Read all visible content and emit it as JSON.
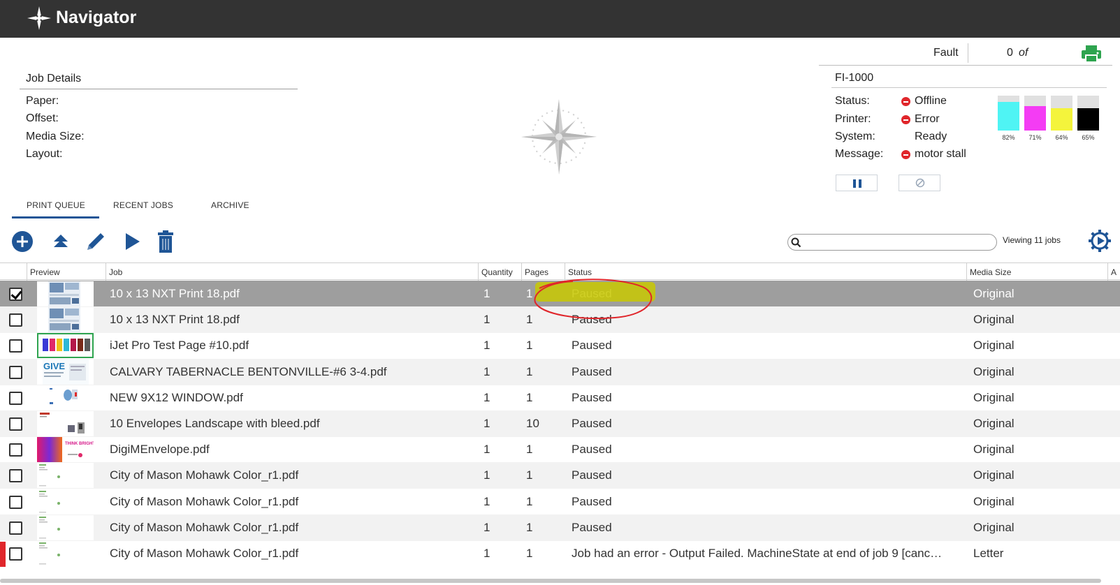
{
  "app": {
    "title": "Navigator"
  },
  "top_status": {
    "fault_label": "Fault",
    "count": "0",
    "of_label": "of"
  },
  "job_details": {
    "title": "Job Details",
    "labels": [
      "Paper:",
      "Offset:",
      "Media Size:",
      "Layout:"
    ]
  },
  "printer": {
    "name": "FI-1000",
    "rows": [
      {
        "label": "Status:",
        "value": "Offline",
        "alert": true
      },
      {
        "label": "Printer:",
        "value": "Error",
        "alert": true
      },
      {
        "label": "System:",
        "value": "Ready",
        "alert": false
      },
      {
        "label": "Message:",
        "value": "motor stall",
        "alert": true
      }
    ],
    "inks": [
      {
        "color": "#4ff4f4",
        "level": 0.82,
        "label": "82%"
      },
      {
        "color": "#f43cf4",
        "level": 0.71,
        "label": "71%"
      },
      {
        "color": "#f4f43c",
        "level": 0.64,
        "label": "64%"
      },
      {
        "color": "#000000",
        "level": 0.65,
        "label": "65%"
      }
    ]
  },
  "tabs": [
    "PRINT QUEUE",
    "RECENT JOBS",
    "ARCHIVE"
  ],
  "toolbar": {
    "viewing": "Viewing 11 jobs",
    "search_placeholder": ""
  },
  "table": {
    "columns": [
      "Preview",
      "Job",
      "Quantity",
      "Pages",
      "Status",
      "Media Size",
      "A"
    ],
    "rows": [
      {
        "job": "10 x 13 NXT Print 18.pdf",
        "quantity": "1",
        "pages": "1",
        "status": "Paused",
        "media": "Original",
        "checked": true,
        "thumb": "brochure"
      },
      {
        "job": "10 x 13 NXT Print 18.pdf",
        "quantity": "1",
        "pages": "1",
        "status": "Paused",
        "media": "Original",
        "checked": false,
        "thumb": "brochure"
      },
      {
        "job": "iJet Pro Test Page #10.pdf",
        "quantity": "1",
        "pages": "1",
        "status": "Paused",
        "media": "Original",
        "checked": false,
        "thumb": "testpage"
      },
      {
        "job": "CALVARY TABERNACLE BENTONVILLE-#6 3-4.pdf",
        "quantity": "1",
        "pages": "1",
        "status": "Paused",
        "media": "Original",
        "checked": false,
        "thumb": "give"
      },
      {
        "job": "NEW 9X12 WINDOW.pdf",
        "quantity": "1",
        "pages": "1",
        "status": "Paused",
        "media": "Original",
        "checked": false,
        "thumb": "window"
      },
      {
        "job": "10 Envelopes Landscape with bleed.pdf",
        "quantity": "1",
        "pages": "10",
        "status": "Paused",
        "media": "Original",
        "checked": false,
        "thumb": "envelope"
      },
      {
        "job": "DigiMEnvelope.pdf",
        "quantity": "1",
        "pages": "1",
        "status": "Paused",
        "media": "Original",
        "checked": false,
        "thumb": "digime"
      },
      {
        "job": "City of Mason Mohawk Color_r1.pdf",
        "quantity": "1",
        "pages": "1",
        "status": "Paused",
        "media": "Original",
        "checked": false,
        "thumb": "mason"
      },
      {
        "job": "City of Mason Mohawk Color_r1.pdf",
        "quantity": "1",
        "pages": "1",
        "status": "Paused",
        "media": "Original",
        "checked": false,
        "thumb": "mason"
      },
      {
        "job": "City of Mason Mohawk Color_r1.pdf",
        "quantity": "1",
        "pages": "1",
        "status": "Paused",
        "media": "Original",
        "checked": false,
        "thumb": "mason"
      },
      {
        "job": "City of Mason Mohawk Color_r1.pdf",
        "quantity": "1",
        "pages": "1",
        "status": "Job had an error - Output Failed. MachineState at end of job 9 [canc…",
        "media": "Letter",
        "checked": false,
        "thumb": "mason",
        "error": true
      }
    ]
  },
  "colors": {
    "accent": "#1f5596",
    "titlebar": "#333333",
    "selected_row": "#9e9e9e",
    "alert": "#e0262b",
    "printer_icon": "#2ea44f"
  }
}
